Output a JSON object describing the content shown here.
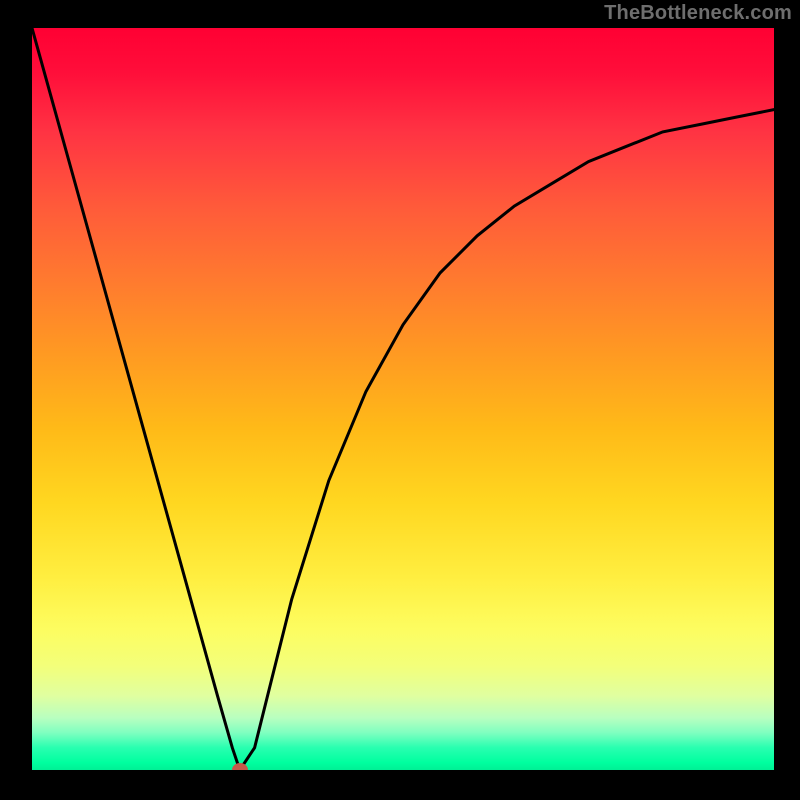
{
  "watermark": "TheBottleneck.com",
  "chart_data": {
    "type": "line",
    "title": "",
    "xlabel": "",
    "ylabel": "",
    "xlim": [
      0,
      100
    ],
    "ylim": [
      0,
      100
    ],
    "grid": false,
    "series": [
      {
        "name": "curve",
        "x": [
          0,
          5,
          10,
          15,
          20,
          25,
          27,
          28,
          30,
          32,
          35,
          40,
          45,
          50,
          55,
          60,
          65,
          70,
          75,
          80,
          85,
          90,
          95,
          100
        ],
        "values": [
          100,
          82,
          64,
          46,
          28,
          10,
          3,
          0,
          3,
          11,
          23,
          39,
          51,
          60,
          67,
          72,
          76,
          79,
          82,
          84,
          86,
          87,
          88,
          89
        ]
      }
    ],
    "marker": {
      "x": 28,
      "y": 0,
      "color": "#c55a4a"
    }
  },
  "colors": {
    "curve": "#000000",
    "frame_bg": "#000000",
    "watermark": "#6e6e6e"
  }
}
